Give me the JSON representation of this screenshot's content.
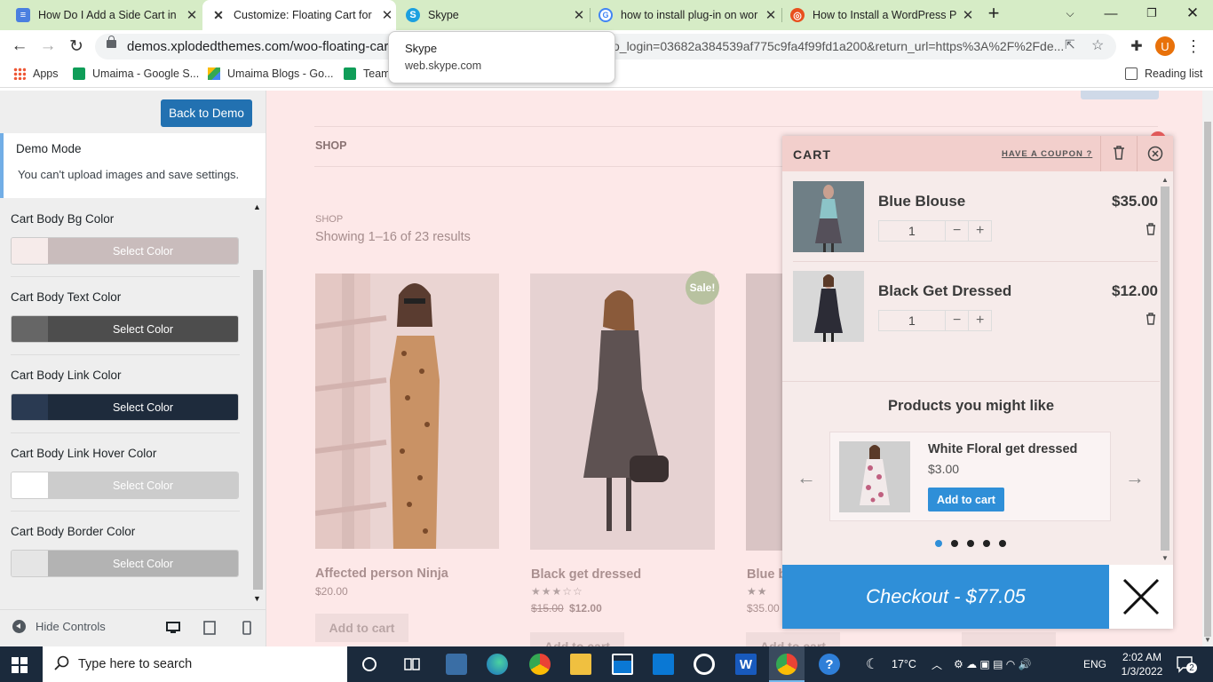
{
  "browser": {
    "tabs": [
      {
        "title": "How Do I Add a Side Cart in",
        "favicon_color": "#4a7fe0"
      },
      {
        "title": "Customize: Floating Cart for",
        "favicon_color": "#333333",
        "active": true
      },
      {
        "title": "Skype",
        "favicon_color": "#1ca0e0"
      },
      {
        "title": "how to install plug-in on wor",
        "favicon_color": "#4285f4"
      },
      {
        "title": "How to Install a WordPress P",
        "favicon_color": "#e8501e"
      }
    ],
    "url": "demos.xplodedthemes.com/woo-floating-cart/w",
    "url_tail": "o_login=03682a384539af775c9fa4f99fd1a200&return_url=https%3A%2F%2Fde...",
    "profile_initial": "U",
    "bookmarks": [
      "Apps",
      "Umaima - Google S...",
      "Umaima Blogs - Go...",
      "Team"
    ],
    "reading_list": "Reading list",
    "tooltip": {
      "title": "Skype",
      "url": "web.skype.com"
    }
  },
  "sidebar": {
    "back_button": "Back to Demo",
    "demo_title": "Demo Mode",
    "demo_text": "You can't upload images and save settings.",
    "controls": [
      {
        "label": "Cart Body Bg Color",
        "button": "Select Color",
        "swatch": "#f6ebea",
        "bar": "#c9bcbc",
        "text": "#ffffff"
      },
      {
        "label": "Cart Body Text Color",
        "button": "Select Color",
        "swatch": "#666666",
        "bar": "#4d4d4d",
        "text": "#ffffff"
      },
      {
        "label": "Cart Body Link Color",
        "button": "Select Color",
        "swatch": "#2a3a52",
        "bar": "#1e2b3c",
        "text": "#ffffff"
      },
      {
        "label": "Cart Body Link Hover Color",
        "button": "Select Color",
        "swatch": "#ffffff",
        "bar": "#cccccc",
        "text": "#ffffff"
      },
      {
        "label": "Cart Body Border Color",
        "button": "Select Color",
        "swatch": "#e5e5e5",
        "bar": "#b3b3b3",
        "text": "#ffffff"
      }
    ],
    "hide_controls": "Hide Controls"
  },
  "shop": {
    "menu": "SHOP",
    "breadcrumb": "SHOP",
    "results": "Showing 1–16 of 23 results",
    "sale_badge": "Sale!",
    "products": [
      {
        "name": "Affected person Ninja",
        "price": "$20.00",
        "button": "Add to cart"
      },
      {
        "name": "Black get dressed",
        "old_price": "$15.00",
        "price": "$12.00",
        "rating": 3,
        "button": "Add to cart"
      },
      {
        "name": "Blue b",
        "price": "$35.00",
        "button": "Add to cart"
      }
    ]
  },
  "cart": {
    "title": "CART",
    "coupon": "HAVE A COUPON ?",
    "items": [
      {
        "name": "Blue Blouse",
        "price": "$35.00",
        "qty": "1",
        "minus": "−",
        "plus": "+"
      },
      {
        "name": "Black Get Dressed",
        "price": "$12.00",
        "qty": "1",
        "minus": "−",
        "plus": "+"
      }
    ],
    "upsell_title": "Products you might like",
    "upsell": {
      "name": "White Floral get dressed",
      "price": "$3.00",
      "button": "Add to cart"
    },
    "dots": 5,
    "active_dot": 0,
    "checkout": "Checkout - $77.05"
  },
  "taskbar": {
    "search_placeholder": "Type here to search",
    "temperature": "17°C",
    "language": "ENG",
    "time": "2:02 AM",
    "date": "1/3/2022",
    "notifications": "2"
  }
}
